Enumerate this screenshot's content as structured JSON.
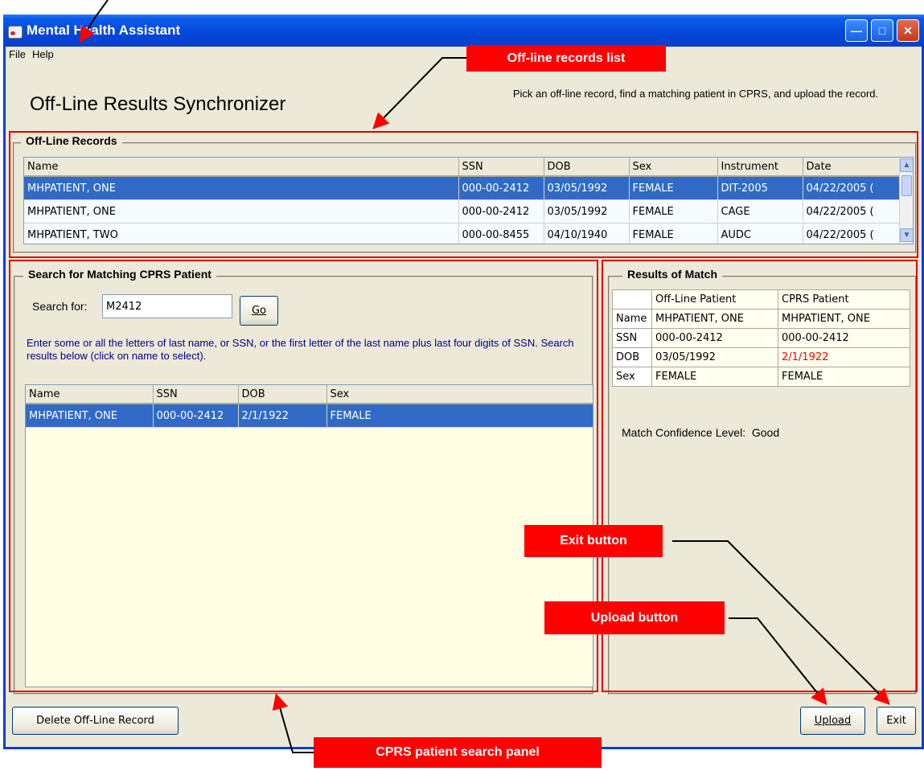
{
  "window": {
    "title": "Mental Health Assistant"
  },
  "menu": [
    "File",
    "Help"
  ],
  "heading": "Off-Line Results Synchronizer",
  "instructions": "Pick an off-line record, find a matching patient in CPRS, and upload the record.",
  "offline_records": {
    "legend": "Off-Line Records",
    "columns": [
      "Name",
      "SSN",
      "DOB",
      "Sex",
      "Instrument",
      "Date"
    ],
    "rows": [
      [
        "MHPATIENT, ONE",
        "000-00-2412",
        "03/05/1992",
        "FEMALE",
        "DIT-2005",
        "04/22/2005 ("
      ],
      [
        "MHPATIENT, ONE",
        "000-00-2412",
        "03/05/1992",
        "FEMALE",
        "CAGE",
        "04/22/2005 ("
      ],
      [
        "MHPATIENT, TWO",
        "000-00-8455",
        "04/10/1940",
        "FEMALE",
        "AUDC",
        "04/22/2005 ("
      ]
    ],
    "selected_row": 0
  },
  "search": {
    "legend": "Search for Matching CPRS Patient",
    "label": "Search for:",
    "value": "M2412",
    "go_label": "Go",
    "hint": "Enter some or all the letters of last name, or SSN, or the first letter of the last name plus last four digits of SSN. Search results below (click on name to select).",
    "columns": [
      "Name",
      "SSN",
      "DOB",
      "Sex"
    ],
    "rows": [
      [
        "MHPATIENT, ONE",
        "000-00-2412",
        "2/1/1922",
        "FEMALE"
      ]
    ]
  },
  "match": {
    "legend": "Results of Match",
    "col1": "Off-Line Patient",
    "col2": "CPRS Patient",
    "rows": [
      {
        "label": "Name",
        "offline": "MHPATIENT, ONE",
        "cprs": "MHPATIENT, ONE"
      },
      {
        "label": "SSN",
        "offline": "000-00-2412",
        "cprs": "000-00-2412"
      },
      {
        "label": "DOB",
        "offline": "03/05/1992",
        "cprs": "2/1/1922"
      },
      {
        "label": "Sex",
        "offline": "FEMALE",
        "cprs": "FEMALE"
      }
    ],
    "confidence": "Match Confidence Level:  Good"
  },
  "buttons": {
    "delete": "Delete Off-Line Record",
    "upload": "Upload",
    "exit": "Exit"
  },
  "callouts": {
    "offline_list": "Off-line records list",
    "exit": "Exit button",
    "upload": "Upload button",
    "search_panel": "CPRS patient search panel"
  },
  "colors": {
    "title_bar": "#0a4ed8",
    "selection": "#316ac5",
    "callout": "#ff0000",
    "mismatch": "#ff0000"
  }
}
